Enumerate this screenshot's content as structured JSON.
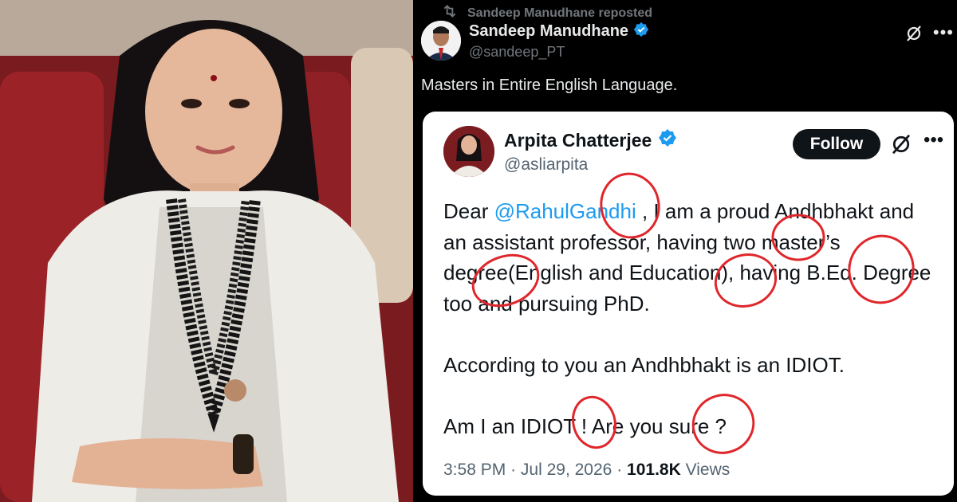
{
  "repost": {
    "text": "Sandeep Manudhane reposted",
    "icon": "repost-icon"
  },
  "quoting_post": {
    "author_name": "Sandeep Manudhane",
    "author_handle": "@sandeep_PT",
    "text": "Masters in Entire English Language.",
    "icons": [
      "verified-badge-icon",
      "grok-icon",
      "more-icon"
    ]
  },
  "quoted_post": {
    "author_name": "Arpita Chatterjee",
    "author_handle": "@asliarpita",
    "follow_label": "Follow",
    "line1_prefix": "Dear ",
    "mention": "@RahulGandhi",
    "line1_rest": " , I am a proud Andhbhakt and",
    "line2": "an assistant professor, having two master’s",
    "line3": "degree(English and Education), having B.Ed. Degree",
    "line4": "too and pursuing PhD.",
    "line5": "According to you an Andhbhakt is an IDIOT.",
    "line6": "Am I an IDIOT ! Are you sure ?",
    "time": "3:58 PM",
    "date": "Jul 29, 2026",
    "views_count": "101.8K",
    "views_label": "Views",
    "separator": "·"
  },
  "annotation_color": "#e0262b"
}
